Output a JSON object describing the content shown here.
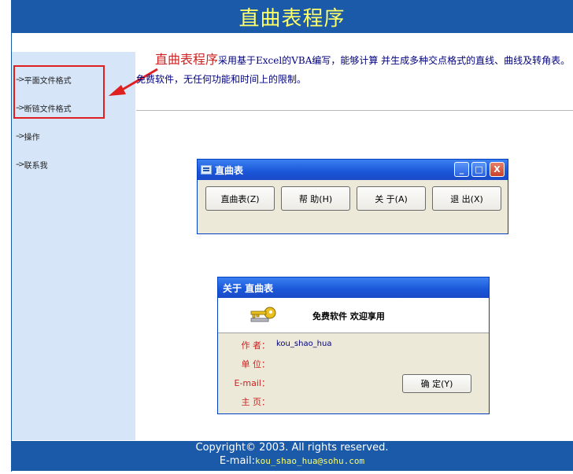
{
  "header": {
    "title": "直曲表程序"
  },
  "sidebar": {
    "items": [
      {
        "label": "平面文件格式"
      },
      {
        "label": "断链文件格式"
      },
      {
        "label": "操作"
      },
      {
        "label": "联系我"
      }
    ],
    "arrow_glyph": "-->"
  },
  "intro": {
    "highlight": "直曲表程序",
    "text": "采用基于Excel的VBA编写，能够计算 并生成多种交点格式的直线、曲线及转角表。免费软件，无任何功能和时间上的限制。"
  },
  "window_main": {
    "title": "直曲表",
    "controls": {
      "minimize": "_",
      "maximize": "□",
      "close": "X"
    },
    "buttons": [
      {
        "label": "直曲表(Z)"
      },
      {
        "label": "帮 助(H)"
      },
      {
        "label": "关 于(A)"
      },
      {
        "label": "退 出(X)"
      }
    ]
  },
  "window_about": {
    "title": "关于 直曲表",
    "banner": "免费软件   欢迎享用",
    "fields": [
      {
        "label": "作 者：",
        "value": "kou_shao_hua"
      },
      {
        "label": "单 位：",
        "value": ""
      },
      {
        "label": "E-mail：",
        "value": ""
      },
      {
        "label": "主 页：",
        "value": ""
      }
    ],
    "ok_button": "确  定(Y)"
  },
  "footer": {
    "copyright": "Copyright© 2003.  All rights reserved.",
    "email_label": "E-mail:",
    "email": "kou_shao_hua@sohu.com"
  },
  "colors": {
    "header_bg": "#1a5aa8",
    "header_text": "#ffff66",
    "sidebar_bg": "#d6e6f8",
    "highlight_red": "#cc2222",
    "annotation_red": "#e02020"
  }
}
